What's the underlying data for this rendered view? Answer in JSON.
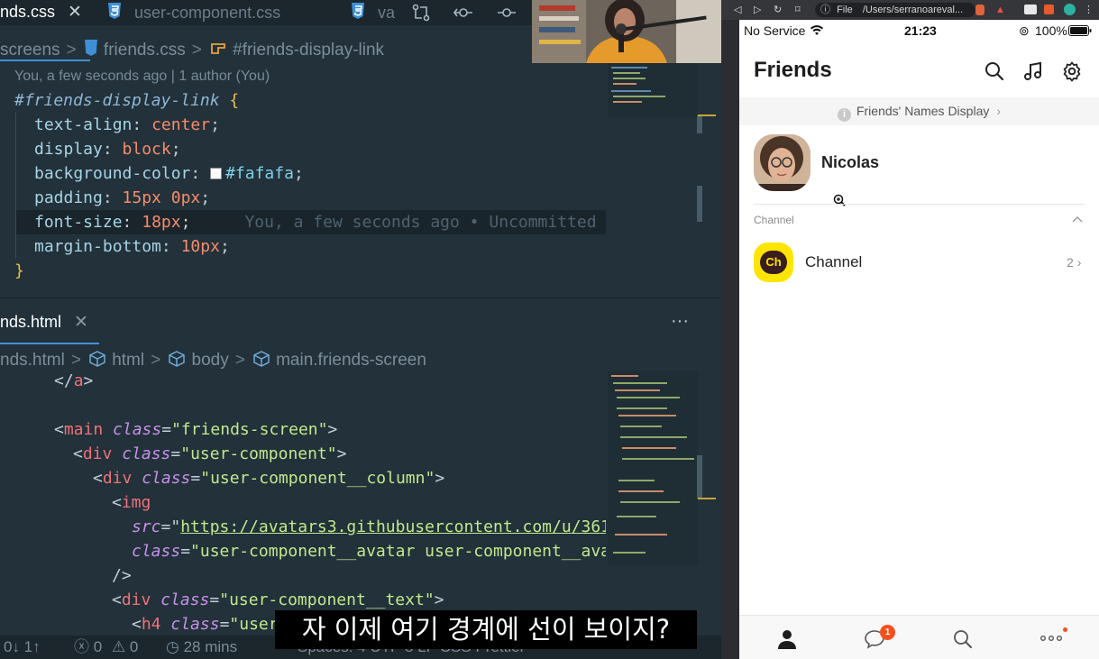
{
  "editor": {
    "tabs": [
      {
        "label": "nds.css",
        "active": true
      },
      {
        "label": "user-component.css",
        "active": false
      },
      {
        "label": "va",
        "active": false
      }
    ],
    "breadcrumb_top": [
      "screens",
      "friends.css",
      "#friends-display-link"
    ],
    "blame_header": "You, a few seconds ago | 1 author (You)",
    "css_lines": [
      {
        "selector": "#friends-display-link",
        "brace": "{"
      },
      {
        "prop": "text-align",
        "value": "center"
      },
      {
        "prop": "display",
        "value": "block"
      },
      {
        "prop": "background-color",
        "value": "#fafafa"
      },
      {
        "prop": "padding",
        "value": "15px 0px"
      },
      {
        "prop": "font-size",
        "value": "18px",
        "blame": "You, a few seconds ago • Uncommitted"
      },
      {
        "prop": "margin-bottom",
        "value": "10px"
      },
      {
        "close": "}"
      }
    ],
    "html_tab": "nds.html",
    "breadcrumb_bottom": [
      "nds.html",
      "html",
      "body",
      "main.friends-screen"
    ],
    "html_lines": {
      "l1_close_a": "a",
      "l3_tag": "main",
      "l3_attr": "class",
      "l3_val": "\"friends-screen\"",
      "l4_tag": "div",
      "l4_attr": "class",
      "l4_val": "\"user-component\"",
      "l5_tag": "div",
      "l5_attr": "class",
      "l5_val": "\"user-component__column\"",
      "l6_tag": "img",
      "l7_attr": "src",
      "l7_val": "https://avatars3.githubusercontent.com/u/361",
      "l8_attr": "class",
      "l8_val": "\"user-component__avatar user-component__ava",
      "l9_close": "/>",
      "l10_tag": "div",
      "l10_attr": "class",
      "l10_val": "\"user-component__text\"",
      "l11_tag": "h4",
      "l11_attr": "class",
      "l11_val": "\"user"
    },
    "more_dots": "···",
    "status": {
      "sync": "0↓ 1↑",
      "errors": "0",
      "warnings": "0",
      "time": "28 mins",
      "partial_right": "Spaces: 4   UTF-8   LF   CSS   Prettier"
    }
  },
  "browser": {
    "file_label": "File",
    "path": "/Users/serranoareval..."
  },
  "phone": {
    "status": {
      "carrier": "No Service",
      "time": "21:23",
      "battery": "100%"
    },
    "title": "Friends",
    "header_icons": [
      "search-icon",
      "music-icon",
      "settings-icon"
    ],
    "names_display": "Friends' Names Display",
    "user_name": "Nicolas",
    "channel_section": "Channel",
    "channel_icon_text": "Ch",
    "channel_name": "Channel",
    "channel_count": "2",
    "chat_badge": "1",
    "bottom_tabs": [
      "person-icon",
      "chat-icon",
      "search-icon",
      "more-icon"
    ],
    "colors": {
      "channel_yellow": "#fee500",
      "badge": "#f4511e"
    }
  },
  "subtitle": "자 이제 여기 경계에 선이 보이지?"
}
